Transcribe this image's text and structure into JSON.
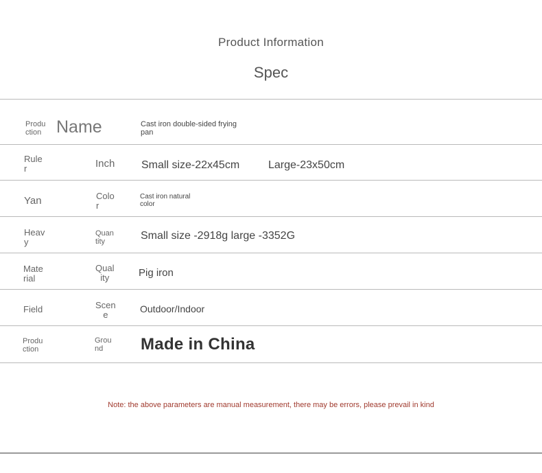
{
  "header": {
    "title": "Product Information",
    "subtitle": "Spec"
  },
  "rows": [
    {
      "label": "Produ\nction",
      "key": "Name",
      "value": "Cast iron double-sided frying\npan"
    },
    {
      "label": "Rule\nr",
      "key": "Inch",
      "value": "Small size-22x45cm",
      "value2": "Large-23x50cm"
    },
    {
      "label": "Yan",
      "key": "Colo\nr",
      "value": "Cast iron natural\ncolor"
    },
    {
      "label": "Heav\ny",
      "key": "Quan\ntity",
      "value": "Small size -2918g large -3352G"
    },
    {
      "label": "Mate\nrial",
      "key": "Qual\nity",
      "value": "Pig iron"
    },
    {
      "label": "Field",
      "key": "Scen\ne",
      "value": "Outdoor/Indoor"
    },
    {
      "label": "Produ\nction",
      "key": "Grou\nnd",
      "value": "Made in China"
    }
  ],
  "note": "Note: the above parameters are manual measurement, there may be errors, please prevail in kind"
}
